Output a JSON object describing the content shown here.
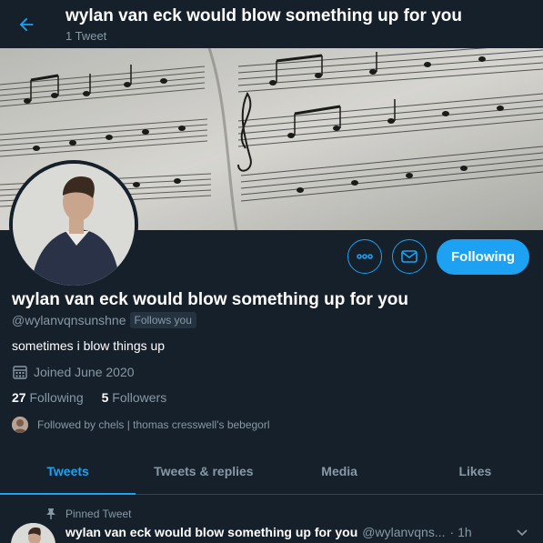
{
  "header": {
    "title": "wylan van eck would blow something up for you",
    "tweet_count": "1 Tweet"
  },
  "profile": {
    "name": "wylan van eck would blow something up for you",
    "handle": "@wylanvqnsunshne",
    "follows_you": "Follows you",
    "bio": "sometimes i blow things up",
    "joined": "Joined June 2020",
    "following_count": "27",
    "following_label": "Following",
    "followers_count": "5",
    "followers_label": "Followers",
    "followed_by": "Followed by chels | thomas cresswell's bebegorl"
  },
  "actions": {
    "follow_button": "Following"
  },
  "tabs": [
    {
      "label": "Tweets",
      "active": true
    },
    {
      "label": "Tweets & replies",
      "active": false
    },
    {
      "label": "Media",
      "active": false
    },
    {
      "label": "Likes",
      "active": false
    }
  ],
  "pinned_tweet": {
    "pinned_label": "Pinned Tweet",
    "name": "wylan van eck would blow something up for you",
    "handle": "@wylanvqns...",
    "time": "· 1h"
  },
  "colors": {
    "background": "#15202b",
    "accent": "#1da1f2",
    "secondary_text": "#8899a6"
  }
}
